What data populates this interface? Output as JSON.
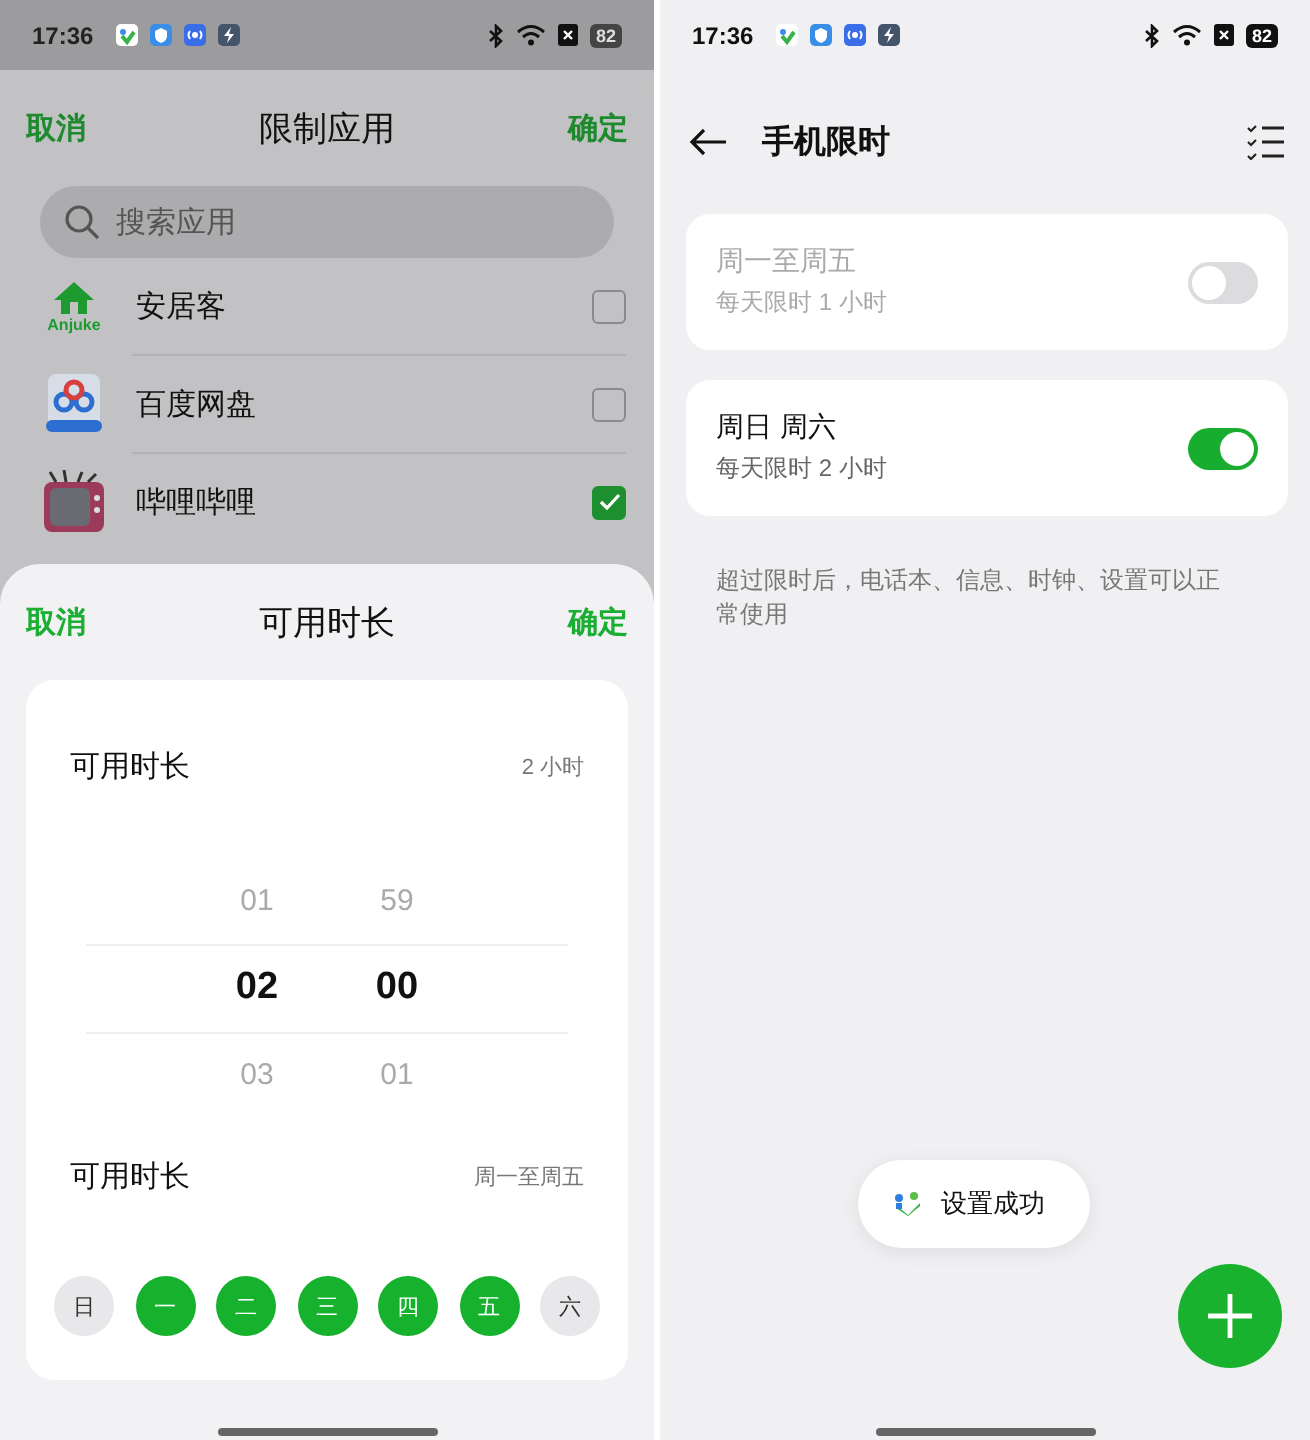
{
  "left_phone": {
    "status_bar": {
      "time": "17:36",
      "battery": "82"
    },
    "app_picker": {
      "cancel": "取消",
      "title": "限制应用",
      "confirm": "确定",
      "search": {
        "placeholder": "搜索应用"
      },
      "apps": [
        {
          "name": "安居客",
          "kind": "house",
          "icon_label": "Anjuke",
          "checked": false
        },
        {
          "name": "百度网盘",
          "kind": "cloud-drive",
          "checked": false
        },
        {
          "name": "哔哩哔哩",
          "kind": "tv",
          "checked": true
        }
      ]
    },
    "duration_sheet": {
      "cancel": "取消",
      "title": "可用时长",
      "confirm": "确定",
      "duration_label": "可用时长",
      "duration_value": "2 小时",
      "hours": [
        {
          "label": "01",
          "selected": false
        },
        {
          "label": "02",
          "selected": true
        },
        {
          "label": "03",
          "selected": false
        }
      ],
      "minutes": [
        {
          "label": "59",
          "selected": false
        },
        {
          "label": "00",
          "selected": true
        },
        {
          "label": "01",
          "selected": false
        }
      ],
      "repeat_label": "可用时长",
      "repeat_value": "周一至周五",
      "days": [
        {
          "label": "日",
          "selected": false
        },
        {
          "label": "一",
          "selected": true
        },
        {
          "label": "二",
          "selected": true
        },
        {
          "label": "三",
          "selected": true
        },
        {
          "label": "四",
          "selected": true
        },
        {
          "label": "五",
          "selected": true
        },
        {
          "label": "六",
          "selected": false
        }
      ]
    }
  },
  "right_phone": {
    "status_bar": {
      "time": "17:36",
      "battery": "82"
    },
    "title": "手机限时",
    "schedules": [
      {
        "title": "周一至周五",
        "subtitle": "每天限时 1 小时",
        "on": false
      },
      {
        "title": "周日 周六",
        "subtitle": "每天限时 2 小时",
        "on": true
      }
    ],
    "note": "超过限时后，电话本、信息、时钟、设置可以正常使用",
    "toast": {
      "text": "设置成功"
    }
  }
}
